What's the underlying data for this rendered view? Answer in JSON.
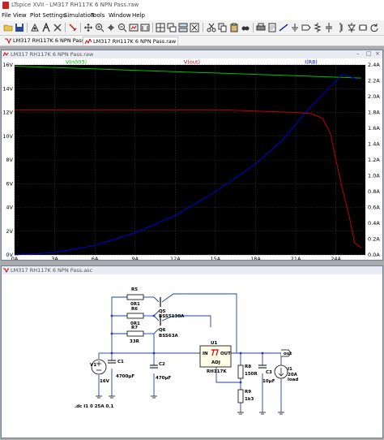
{
  "window": {
    "title": "LTspice XVII - LM317 RH117K 6 NPN Pass.raw"
  },
  "menu": [
    "File",
    "View",
    "Plot Settings",
    "Simulation",
    "Tools",
    "Window",
    "Help"
  ],
  "tabs": [
    {
      "label": "LM317 RH117K 6 NPN Pass.asc"
    },
    {
      "label": "LM317 RH117K 6 NPN Pass.raw"
    }
  ],
  "plot_window": {
    "title": "LM317 RH117K 6 NPN Pass.raw"
  },
  "schematic_window": {
    "title": "LM317 RH117K 6 NPN Pass.asc"
  },
  "colors": {
    "green": "#00c000",
    "red": "#c00000",
    "blue": "#0000e0",
    "plot_bg": "#000000",
    "grid": "#3a3a3a",
    "axis_text": "#000000"
  },
  "chart_data": {
    "type": "line",
    "xlabel": "",
    "x_ticks": [
      "0A",
      "3A",
      "6A",
      "9A",
      "12A",
      "15A",
      "18A",
      "21A",
      "24A"
    ],
    "xlim": [
      0,
      26.2
    ],
    "y_left_ticks": [
      "0V",
      "2V",
      "4V",
      "6V",
      "8V",
      "10V",
      "12V",
      "14V",
      "16V"
    ],
    "ylim_left": [
      0,
      16
    ],
    "y_right_ticks": [
      "0.0A",
      "0.2A",
      "0.4A",
      "0.6A",
      "0.8A",
      "1.0A",
      "1.2A",
      "1.4A",
      "1.6A",
      "1.8A",
      "2.0A",
      "2.2A",
      "2.4A"
    ],
    "ylim_right": [
      0,
      2.4
    ],
    "series": [
      {
        "name": "V(n003)",
        "axis": "left",
        "color": "#00c000",
        "x": [
          0,
          25.9
        ],
        "y": [
          15.9,
          14.9
        ]
      },
      {
        "name": "V(out)",
        "axis": "left",
        "color": "#c00000",
        "x": [
          0,
          16,
          21,
          22.2,
          23.0,
          23.6,
          24.0,
          24.5,
          25.0,
          25.4,
          25.9
        ],
        "y": [
          12.2,
          12.2,
          12.0,
          11.9,
          11.5,
          10.2,
          8.0,
          5.5,
          3.2,
          1.0,
          0.6
        ]
      },
      {
        "name": "I(R8)",
        "axis": "right",
        "color": "#0000e0",
        "x": [
          0,
          3,
          6,
          9,
          12,
          15,
          18,
          20,
          22,
          23.3,
          24.5,
          25.6
        ],
        "y": [
          0.0,
          0.03,
          0.12,
          0.28,
          0.5,
          0.8,
          1.15,
          1.45,
          1.85,
          2.08,
          2.28,
          2.22
        ]
      }
    ]
  },
  "schematic": {
    "R5": {
      "name": "R5",
      "value": "0R1"
    },
    "R6": {
      "name": "R6",
      "value": "0R1"
    },
    "R7": {
      "name": "R7",
      "value": "33R"
    },
    "Q5": {
      "name": "Q5",
      "value": "BSS5130A"
    },
    "Q6": {
      "name": "Q6",
      "value": "BSS63A"
    },
    "U1": {
      "name": "U1",
      "in": "IN",
      "out": "OUT",
      "adj": "ADJ",
      "part": "RH117K"
    },
    "V1": {
      "name": "V1",
      "value": "16V"
    },
    "C1": {
      "name": "C1",
      "value": "4700µF"
    },
    "C2": {
      "name": "C2",
      "value": "470µF"
    },
    "R8": {
      "name": "R8",
      "value": "150R"
    },
    "R9": {
      "name": "R9",
      "value": "1k3"
    },
    "C3": {
      "name": "C3",
      "value": "10µF"
    },
    "I1": {
      "name": "I1",
      "value": "20A",
      "extra": "load"
    },
    "out_label": "out",
    "directive": ".dc I1 0 25A 0.1"
  }
}
